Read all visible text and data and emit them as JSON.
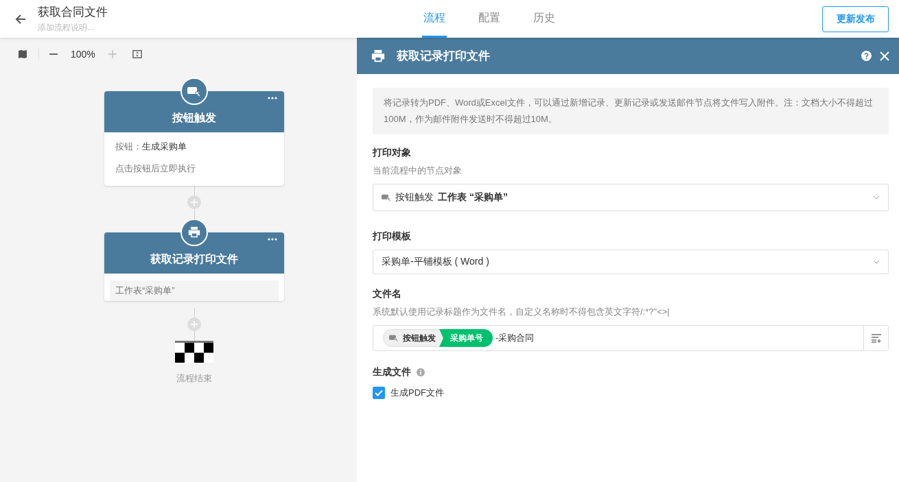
{
  "header": {
    "title": "获取合同文件",
    "description_placeholder": "添加流程说明...",
    "tabs": [
      {
        "label": "流程",
        "selected": true
      },
      {
        "label": "配置",
        "selected": false
      },
      {
        "label": "历史",
        "selected": false
      }
    ],
    "publish_button": "更新发布"
  },
  "canvas": {
    "zoom": "100%",
    "nodes": [
      {
        "kind": "trigger",
        "title": "按钮触发",
        "detail_label": "按钮：",
        "detail_value": "生成采购单",
        "note": "点击按钮后立即执行"
      },
      {
        "kind": "print",
        "title": "获取记录打印文件",
        "summary": "工作表“采购单”"
      }
    ],
    "end_label": "流程结束"
  },
  "panel": {
    "title": "获取记录打印文件",
    "info": "将记录转为PDF、Word或Excel文件，可以通过新增记录、更新记录或发送邮件节点将文件写入附件。注：文档大小不得超过100M，作为邮件附件发送时不得超过10M。",
    "print_object": {
      "label": "打印对象",
      "hint": "当前流程中的节点对象",
      "node": "按钮触发",
      "value": "工作表 “采购单”"
    },
    "template": {
      "label": "打印模板",
      "value": "采购单-平铺模板 ( Word )"
    },
    "file_name": {
      "label": "文件名",
      "hint": "系统默认使用记录标题作为文件名，自定义名称时不得包含英文字符/:*?\"<>|",
      "tags": [
        {
          "kind": "node",
          "text": "按钮触发"
        },
        {
          "kind": "field",
          "text": "采购单号"
        }
      ],
      "suffix": "-采购合同"
    },
    "generate": {
      "label": "生成文件",
      "options": [
        {
          "label": "生成PDF文件",
          "checked": true
        }
      ]
    }
  }
}
